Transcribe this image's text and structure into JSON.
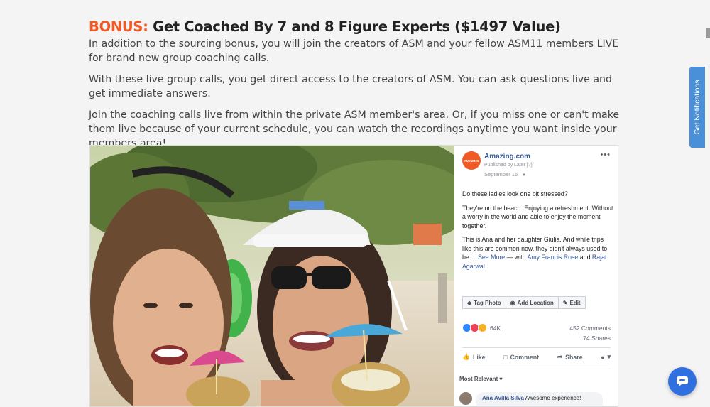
{
  "section": {
    "bonus_label": "BONUS:",
    "heading": "Get Coached By 7 and 8 Figure Experts ($1497 Value)",
    "paragraphs": [
      "In addition to the sourcing bonus, you will join the creators of ASM and your fellow ASM11 members LIVE for brand new group coaching calls.",
      "With these live group calls, you get direct access to the creators of ASM. You can ask questions live and get immediate answers.",
      "Join the coaching calls live from within the private ASM member's area. Or, if you miss one or can't make them live because of your current schedule, you can watch the recordings anytime you want inside your members area!"
    ]
  },
  "facebook_post": {
    "avatar_text": "AMAZING",
    "page_name": "Amazing.com",
    "published_by": "Published by Later [?]",
    "date": "September 16 ·",
    "more_icon": "ellipsis-icon",
    "body": {
      "p1": "Do these ladies look one bit stressed?",
      "p2": "They're on the beach. Enjoying a refreshment. Without a worry in the world and able to enjoy the moment together.",
      "p3_text": "This is Ana and her daughter Giulia. And while trips like this are common now, they didn't always used to be....",
      "see_more": "See More",
      "with_text": "— with",
      "person1": "Amy Francis Rose",
      "and_text": "and",
      "person2": "Rajat Agarwal",
      "end": "."
    },
    "actions": {
      "tag_photo": "Tag Photo",
      "add_location": "Add Location",
      "edit": "Edit"
    },
    "stats": {
      "reactions": "64K",
      "comments": "452 Comments",
      "shares": "74 Shares"
    },
    "bar": {
      "like": "Like",
      "comment": "Comment",
      "share": "Share"
    },
    "sort_label": "Most Relevant ▾",
    "comment": {
      "name": "Ana Avilla Silva",
      "text": "Awesome experience!"
    }
  },
  "widgets": {
    "notifications_label": "Get Notifications",
    "chat_icon": "chat-icon"
  },
  "colors": {
    "bonus": "#f15a24",
    "notify_tab": "#4a90d9",
    "chat_button": "#2f6fe0",
    "fb_link": "#385898"
  }
}
